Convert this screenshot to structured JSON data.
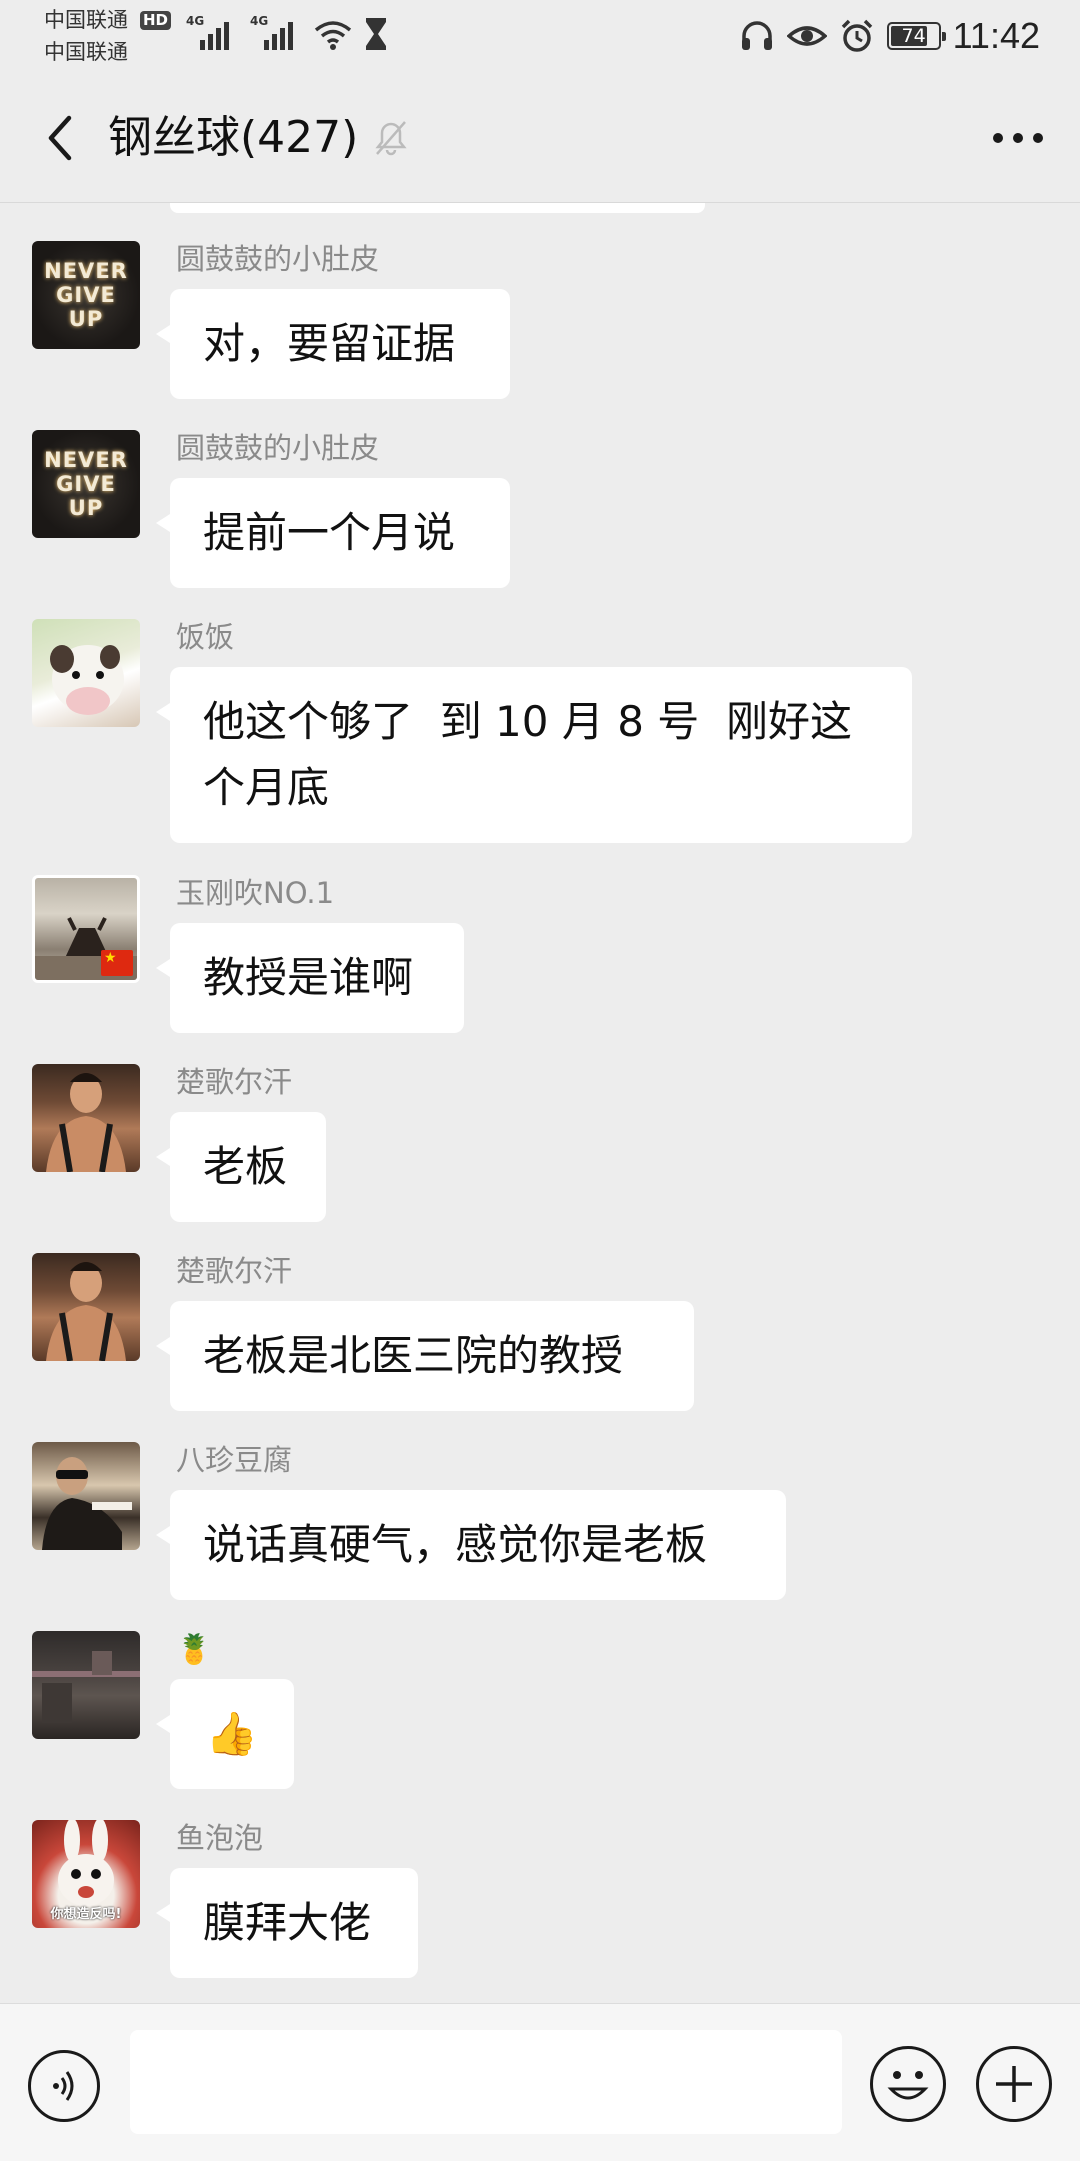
{
  "status_bar": {
    "carrier1": "中国联通",
    "carrier2": "中国联通",
    "hd_badge": "HD",
    "net_type1": "4G",
    "net_type2": "4G",
    "battery_level": "74",
    "time": "11:42",
    "icons": [
      "headset-icon",
      "eye-icon",
      "alarm-icon",
      "battery-icon",
      "wifi-icon",
      "hourglass-icon",
      "signal-icon"
    ]
  },
  "header": {
    "title": "钢丝球(427)",
    "back_icon": "chevron-left-icon",
    "mute_icon": "bell-off-icon",
    "more_icon": "more-dots-icon"
  },
  "messages": [
    {
      "sender": "圆鼓鼓的小肚皮",
      "text": "对，要留证据",
      "avatar": "avatar-never-give-up",
      "avatar_text": [
        "NEVER",
        "GIVE",
        "UP"
      ]
    },
    {
      "sender": "圆鼓鼓的小肚皮",
      "text": "提前一个月说",
      "avatar": "avatar-never-give-up",
      "avatar_text": [
        "NEVER",
        "GIVE",
        "UP"
      ]
    },
    {
      "sender": "饭饭",
      "text_line1": "他这个够了  到 10 月 8 号  刚好这",
      "text_line2": "个月底",
      "avatar": "avatar-cow-plush"
    },
    {
      "sender": "玉刚吹NO.1",
      "text": "教授是谁啊",
      "avatar": "avatar-flag"
    },
    {
      "sender": "楚歌尔汗",
      "text": "老板",
      "avatar": "avatar-man"
    },
    {
      "sender": "楚歌尔汗",
      "text": "老板是北医三院的教授",
      "avatar": "avatar-man"
    },
    {
      "sender": "八珍豆腐",
      "text": "说话真硬气，感觉你是老板",
      "avatar": "avatar-sunglasses"
    },
    {
      "sender": "🍍",
      "text": "👍",
      "avatar": "avatar-dark-room"
    },
    {
      "sender": "鱼泡泡",
      "text": "膜拜大佬",
      "avatar": "avatar-bunny",
      "avatar_caption": "你想造反吗!"
    }
  ],
  "input_bar": {
    "voice_icon": "voice-icon",
    "input_value": "",
    "emoji_icon": "emoji-icon",
    "plus_icon": "plus-icon"
  }
}
